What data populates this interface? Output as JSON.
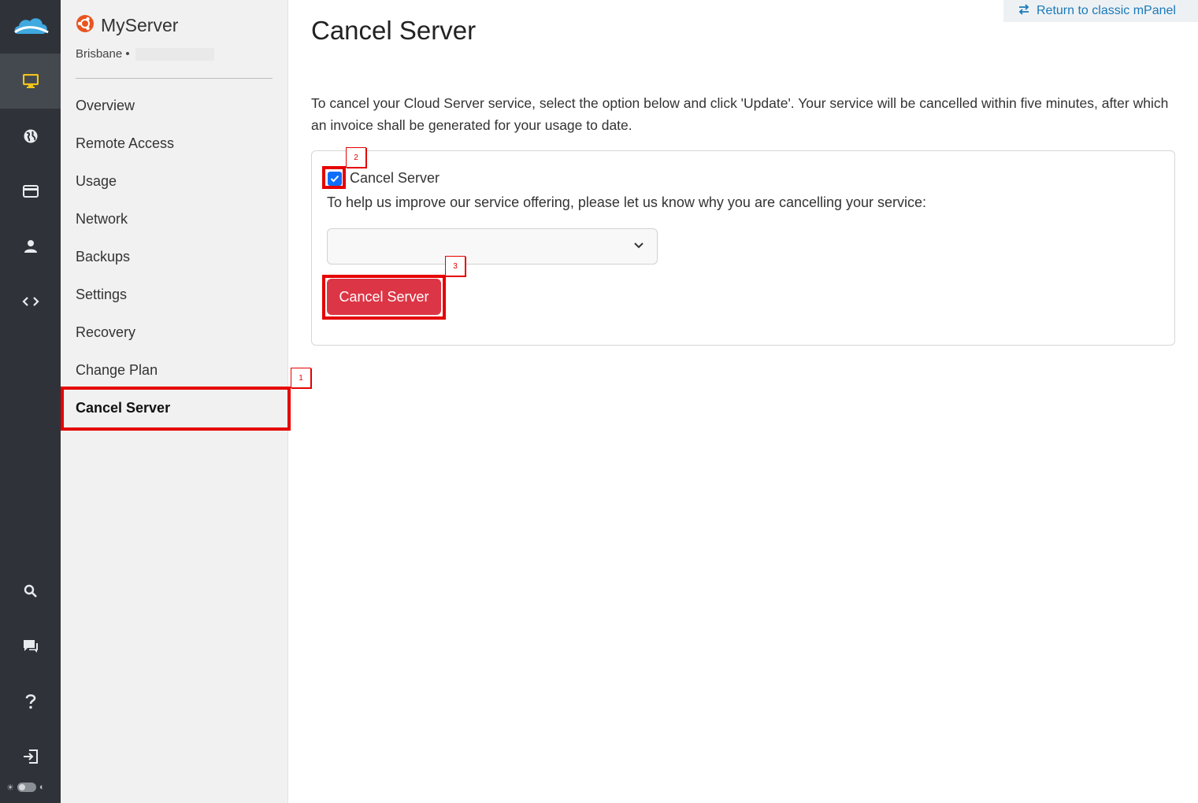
{
  "rail": {
    "items": [
      {
        "icon": "monitor-icon",
        "active": true
      },
      {
        "icon": "globe-icon",
        "active": false
      },
      {
        "icon": "credit-card-icon",
        "active": false
      },
      {
        "icon": "user-icon",
        "active": false
      },
      {
        "icon": "code-icon",
        "active": false
      },
      {
        "icon": "search-icon",
        "active": false
      },
      {
        "icon": "chat-icon",
        "active": false
      },
      {
        "icon": "help-icon",
        "active": false
      },
      {
        "icon": "logout-icon",
        "active": false
      }
    ],
    "accent_color": "#f5c518"
  },
  "subnav": {
    "server_name": "MyServer",
    "location": "Brisbane •",
    "items": [
      {
        "label": "Overview"
      },
      {
        "label": "Remote Access"
      },
      {
        "label": "Usage"
      },
      {
        "label": "Network"
      },
      {
        "label": "Backups"
      },
      {
        "label": "Settings"
      },
      {
        "label": "Recovery"
      },
      {
        "label": "Change Plan"
      },
      {
        "label": "Cancel Server",
        "active": true
      }
    ]
  },
  "header": {
    "classic_link": "Return to classic mPanel"
  },
  "main": {
    "title": "Cancel Server",
    "intro": "To cancel your Cloud Server service, select the option below and click 'Update'. Your service will be cancelled within five minutes, after which an invoice shall be generated for your usage to date.",
    "form": {
      "checkbox_label": "Cancel Server",
      "checkbox_checked": true,
      "help_text": "To help us improve our service offering, please let us know why you are cancelling your service:",
      "reason_selected": "",
      "submit_label": "Cancel Server"
    }
  },
  "annotations": {
    "tags": [
      "1",
      "2",
      "3"
    ],
    "color": "#e60000"
  },
  "colors": {
    "rail_bg": "#2f3339",
    "danger": "#dc3545",
    "link": "#1a7ab8",
    "checkbox": "#0d6efd"
  }
}
